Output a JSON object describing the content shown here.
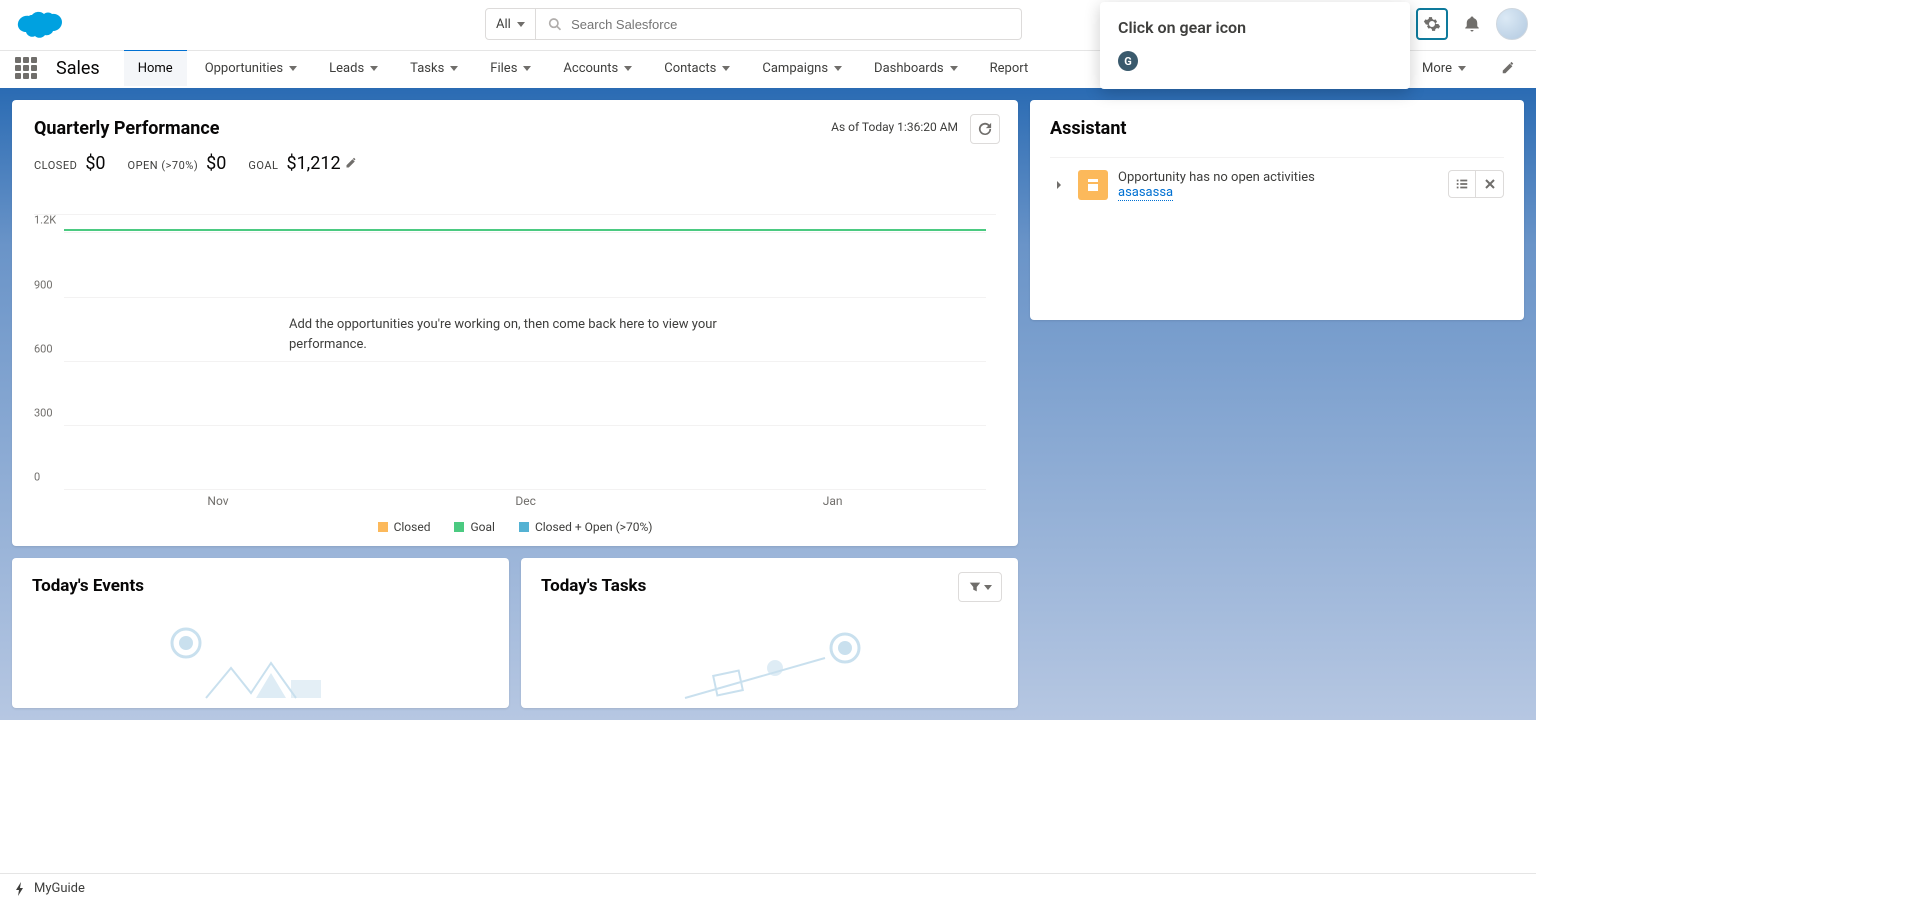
{
  "header": {
    "search_scope": "All",
    "search_placeholder": "Search Salesforce"
  },
  "tooltip": {
    "title": "Click on gear icon"
  },
  "nav": {
    "app_name": "Sales",
    "items": [
      "Home",
      "Opportunities",
      "Leads",
      "Tasks",
      "Files",
      "Accounts",
      "Contacts",
      "Campaigns",
      "Dashboards",
      "Report"
    ],
    "more": "More"
  },
  "perf": {
    "title": "Quarterly Performance",
    "asof": "As of Today 1:36:20 AM",
    "closed_label": "CLOSED",
    "closed_value": "$0",
    "open_label": "OPEN (>70%)",
    "open_value": "$0",
    "goal_label": "GOAL",
    "goal_value": "$1,212",
    "hint": "Add the opportunities you're working on, then come back here to view your performance.",
    "legend": [
      "Closed",
      "Goal",
      "Closed + Open (>70%)"
    ]
  },
  "chart_data": {
    "type": "line",
    "categories": [
      "Nov",
      "Dec",
      "Jan"
    ],
    "series": [
      {
        "name": "Closed",
        "values": [
          0,
          0,
          0
        ],
        "color": "#fcb95b"
      },
      {
        "name": "Goal",
        "values": [
          1212,
          1212,
          1212
        ],
        "color": "#4bca81"
      },
      {
        "name": "Closed + Open (>70%)",
        "values": [
          0,
          0,
          0
        ],
        "color": "#54b2d3"
      }
    ],
    "y_ticks": [
      0,
      300,
      600,
      900,
      1200
    ],
    "y_tick_labels": [
      "0",
      "300",
      "600",
      "900",
      "1.2K"
    ],
    "ylim": [
      0,
      1300
    ],
    "xlabel": "",
    "ylabel": ""
  },
  "events": {
    "title": "Today's Events"
  },
  "tasks": {
    "title": "Today's Tasks"
  },
  "assistant": {
    "title": "Assistant",
    "item_text": "Opportunity has no open activities",
    "item_link": "asasassa"
  },
  "bottom": {
    "label": "MyGuide"
  },
  "colors": {
    "closed": "#fcb95b",
    "goal": "#4bca81",
    "openclosed": "#54b2d3"
  }
}
